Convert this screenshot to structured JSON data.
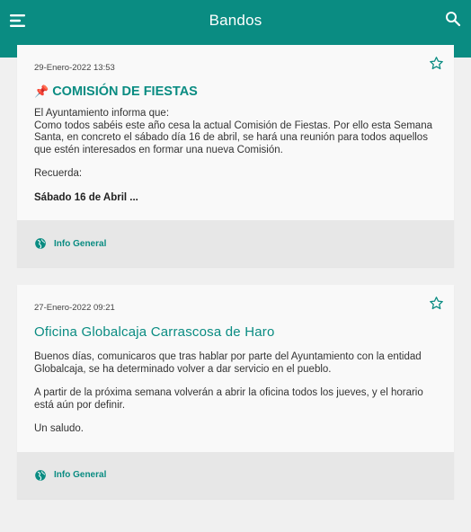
{
  "appbar": {
    "title": "Bandos",
    "menu_icon": "menu-icon",
    "search_icon": "search-icon"
  },
  "colors": {
    "accent": "#0a8c82"
  },
  "posts": [
    {
      "date": "29-Enero-2022 13:53",
      "title": "COMISIÓN DE FIESTAS",
      "pin_icon": "pushpin-icon",
      "paragraphs": [
        "El Ayuntamiento informa que:",
        "Como todos sabéis este año cesa la actual Comisión de Fiestas. Por ello esta Semana Santa, en concreto el sábado día 16 de abril, se hará una reunión para todos aquellos que estén interesados en formar una nueva Comisión.",
        "Recuerda:",
        "Sábado 16 de Abril ..."
      ],
      "category": "Info General"
    },
    {
      "date": "27-Enero-2022 09:21",
      "title": "Oficina Globalcaja Carrascosa de Haro",
      "paragraphs": [
        "Buenos días, comunicaros que tras hablar por parte del Ayuntamiento con la entidad Globalcaja, se ha determinado volver a dar servicio en el pueblo.",
        "A partir de la próxima semana volverán a abrir la oficina todos los jueves, y el horario está aún por definir.",
        "Un saludo."
      ],
      "category": "Info General"
    }
  ]
}
